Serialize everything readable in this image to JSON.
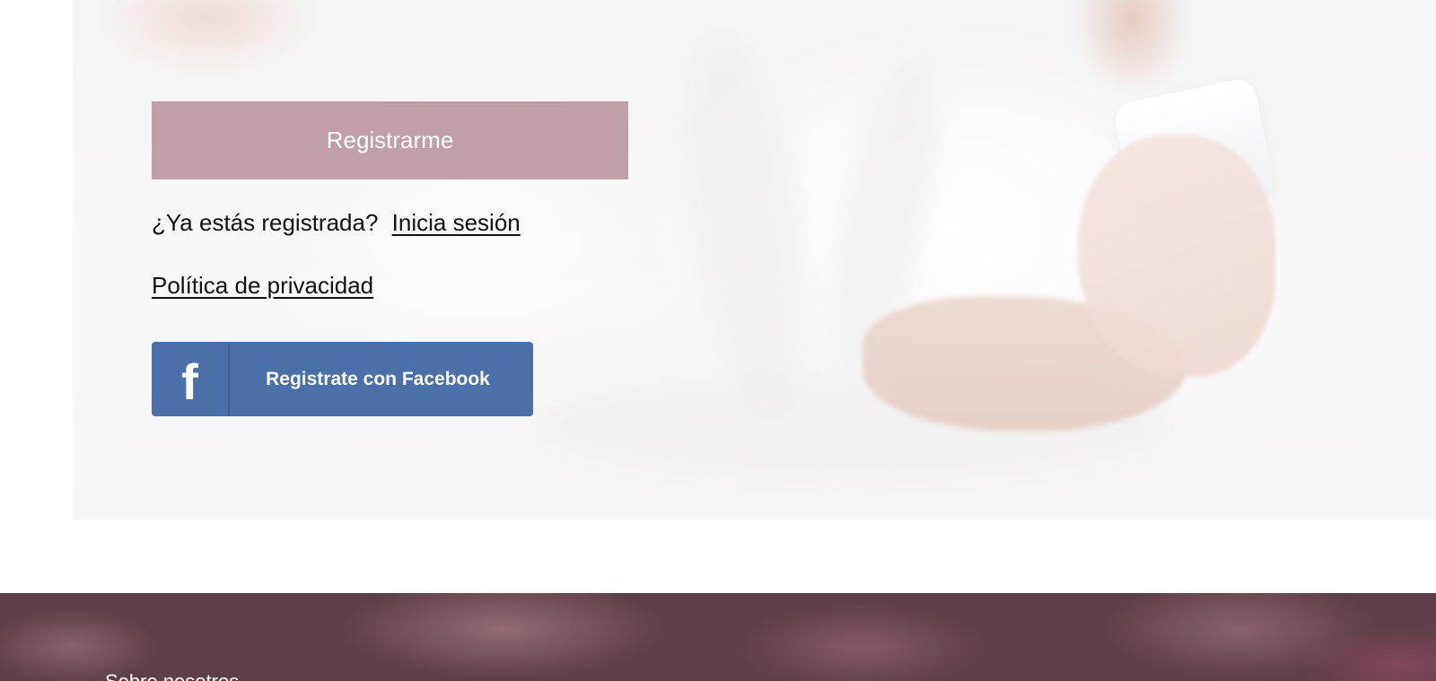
{
  "register": {
    "button_label": "Registrarme"
  },
  "login": {
    "prompt": "¿Ya estás registrada?",
    "link_label": "Inicia sesión"
  },
  "privacy": {
    "link_label": "Política de privacidad"
  },
  "facebook": {
    "icon_glyph": "f",
    "button_label": "Registrate con Facebook",
    "color": "#4a6fa9"
  },
  "footer": {
    "heading": "Sobre nosotros",
    "background_color": "#5e3f49"
  },
  "colors": {
    "register_button": "#c0a0a6",
    "text": "#111111"
  }
}
